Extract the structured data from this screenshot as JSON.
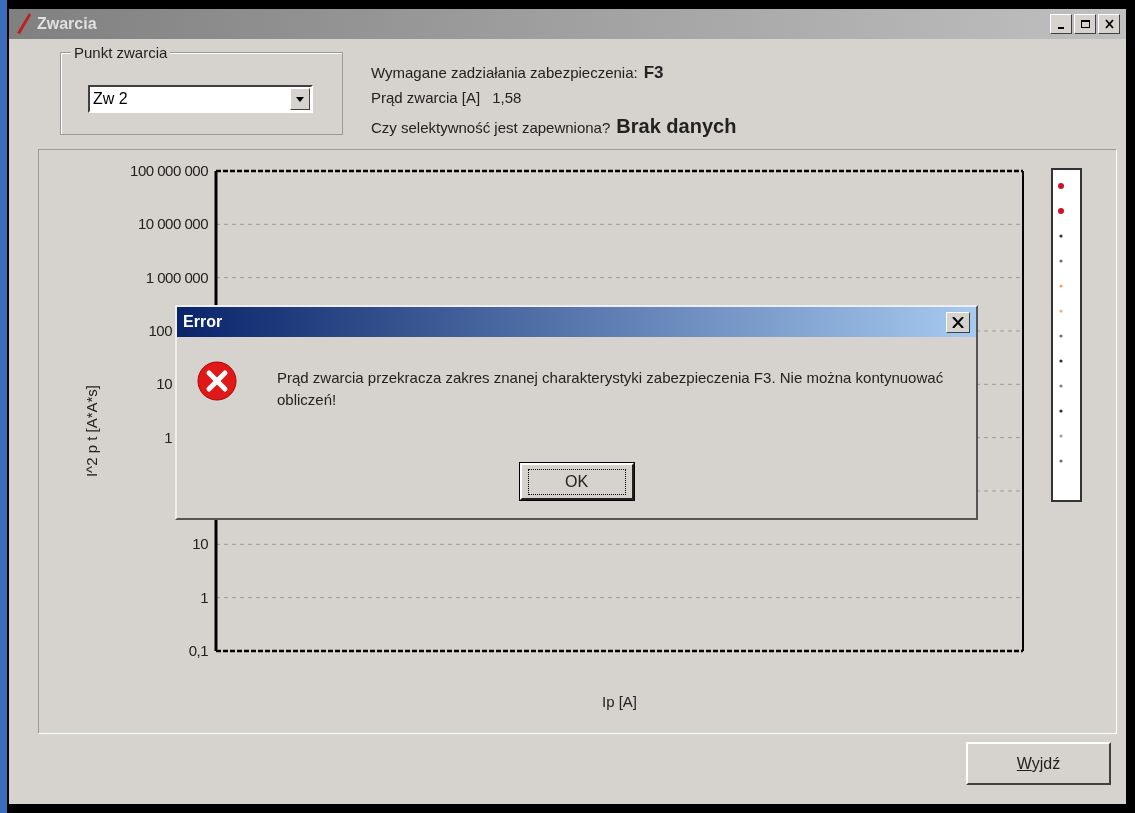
{
  "window": {
    "title": "Zwarcia"
  },
  "fault_point": {
    "group_label": "Punkt zwarcia",
    "value": "Zw 2"
  },
  "info": [
    {
      "label": "Wymagane zadziałania zabezpieczenia:",
      "value": "F3",
      "kind": "bold"
    },
    {
      "label": "Prąd zwarcia [A]",
      "value": "1,58",
      "kind": "plain"
    },
    {
      "label": "Czy selektywność jest zapewniona?",
      "value": "Brak danych",
      "kind": "large"
    }
  ],
  "chart": {
    "xlabel": "Ip [A]",
    "ylabel": "I^2 p t [A*A*s]",
    "y_labels_upper": [
      "100 000 000",
      "10 000 000",
      "1 000 000"
    ],
    "y_label_fragments": [
      "100",
      "10",
      "1"
    ],
    "y_labels_lower": [
      "10",
      "1",
      "0,1"
    ],
    "legend": [
      {
        "color": "#d0102a"
      },
      {
        "color": "#d0102a"
      },
      {
        "color": "#303030"
      },
      {
        "color": "#707070"
      },
      {
        "color": "#f0a060"
      },
      {
        "color": "#f0b080"
      },
      {
        "color": "#707070"
      },
      {
        "color": "#303030"
      },
      {
        "color": "#808080"
      },
      {
        "color": "#303030"
      },
      {
        "color": "#a0a0a0"
      },
      {
        "color": "#707070"
      }
    ]
  },
  "exit_button": "Wyjdź",
  "dialog": {
    "title": "Error",
    "message": "Prąd zwarcia przekracza zakres znanej charakterystyki zabezpieczenia F3. Nie można kontynuować obliczeń!",
    "button": "OK"
  }
}
